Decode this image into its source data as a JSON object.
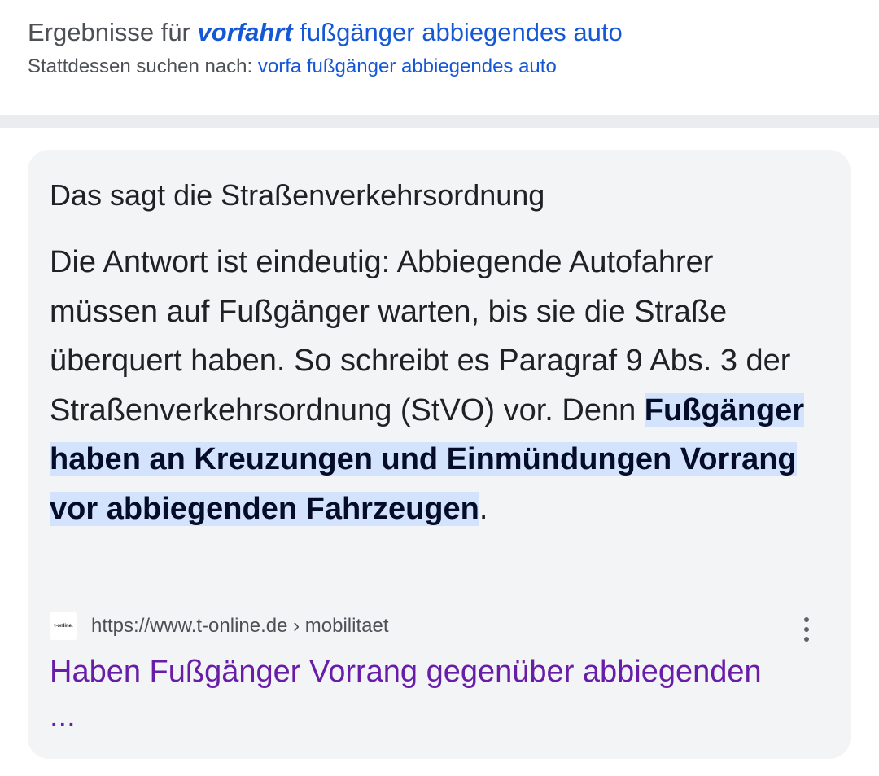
{
  "correction": {
    "results_prefix": "Ergebnisse für",
    "query_corrected": "vorfahrt",
    "query_rest": "fußgänger abbiegendes auto",
    "instead_prefix": "Stattdessen suchen nach:",
    "instead_query": "vorfa fußgänger abbiegendes auto"
  },
  "featured_snippet": {
    "heading": "Das sagt die Straßenverkehrsordnung",
    "text_before": "Die Antwort ist eindeutig: Abbiegende Autofahrer müssen auf Fußgänger warten, bis sie die Straße überquert haben. So schreibt es Paragraf 9 Abs. 3 der Straßenverkehrsordnung (StVO) vor. Denn ",
    "text_highlight": "Fußgänger haben an Kreuzungen und Einmündungen Vorrang vor abbiegenden Fahrzeugen",
    "text_after": ".",
    "source": {
      "favicon_text": "t-online.",
      "url": "https://www.t-online.de › mobilitaet",
      "more_icon": "more-vert-icon"
    },
    "title": "Haben Fußgänger Vorrang gegenüber abbiegenden ..."
  },
  "colors": {
    "link_blue": "#1558d6",
    "visited_purple": "#681da8",
    "highlight_bg": "#d3e3fd",
    "card_bg": "#f3f4f6"
  }
}
